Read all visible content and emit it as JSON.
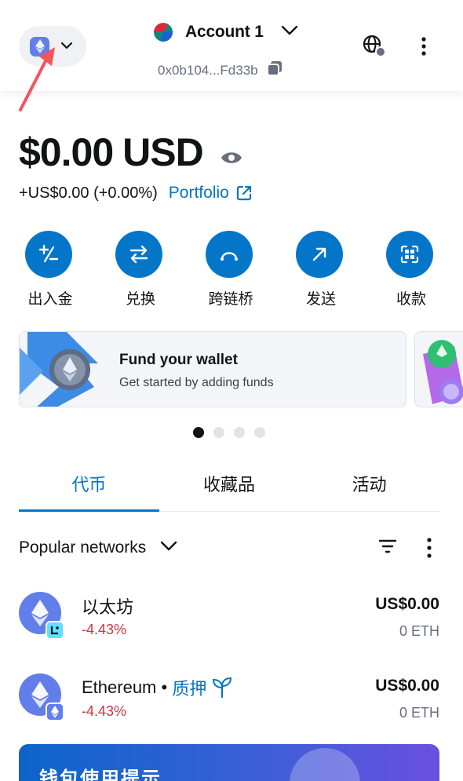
{
  "header": {
    "account_name": "Account 1",
    "address": "0x0b104...Fd33b"
  },
  "balance": {
    "amount": "$0.00",
    "currency": "USD",
    "change": "+US$0.00 (+0.00%)",
    "portfolio_label": "Portfolio"
  },
  "actions": [
    {
      "label": "出入金",
      "icon": "plus-minus-icon"
    },
    {
      "label": "兑换",
      "icon": "swap-icon"
    },
    {
      "label": "跨链桥",
      "icon": "bridge-icon"
    },
    {
      "label": "发送",
      "icon": "send-arrow-icon"
    },
    {
      "label": "收款",
      "icon": "receive-qr-icon"
    }
  ],
  "promo": {
    "title": "Fund your wallet",
    "subtitle": "Get started by adding funds"
  },
  "carousel": {
    "count": 4,
    "active": 0
  },
  "tabs": [
    {
      "label": "代币",
      "active": true
    },
    {
      "label": "收藏品",
      "active": false
    },
    {
      "label": "活动",
      "active": false
    }
  ],
  "filter": {
    "label": "Popular networks"
  },
  "tokens": [
    {
      "name": "以太坊",
      "change": "-4.43%",
      "value": "US$0.00",
      "amount": "0 ETH",
      "badge": "linea-badge-icon"
    },
    {
      "name": "Ethereum • ",
      "stake_label": "质押",
      "change": "-4.43%",
      "value": "US$0.00",
      "amount": "0 ETH",
      "badge": "ethereum-badge-icon"
    }
  ],
  "tips": {
    "title": "钱包使用提示"
  },
  "colors": {
    "accent": "#0376c9",
    "negative": "#ca3542",
    "eth": "#627eea"
  }
}
